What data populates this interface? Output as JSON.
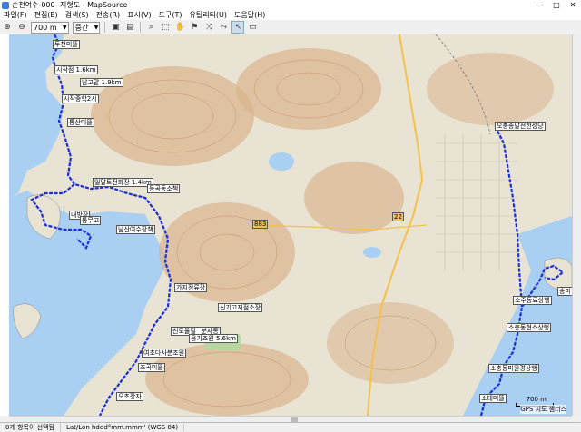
{
  "window": {
    "title": "순천여수-000- 지형도 - MapSource",
    "min": "—",
    "max": "□",
    "close": "✕"
  },
  "menu": [
    "파일(F)",
    "편집(E)",
    "검색(S)",
    "전송(R)",
    "표시(V)",
    "도구(T)",
    "유틸리티(U)",
    "도움말(H)"
  ],
  "toolbar": {
    "zoom_value": "700 m",
    "detail_value": "중간"
  },
  "map": {
    "scale_label": "700 m",
    "watermark": "GPS 지도 샘터스",
    "pois": [
      {
        "text": "두쳔미뜰",
        "name": "poi-1"
      },
      {
        "text": "시작점 1.6km",
        "name": "poi-2"
      },
      {
        "text": "남고말 1.9km",
        "name": "poi-3"
      },
      {
        "text": "시작중학2시",
        "name": "poi-4"
      },
      {
        "text": "통산미뜰",
        "name": "poi-5"
      },
      {
        "text": "일달트전화장 1.4km",
        "name": "poi-6"
      },
      {
        "text": "등곡동소책",
        "name": "poi-7"
      },
      {
        "text": "내방장",
        "name": "poi-8"
      },
      {
        "text": "통무고",
        "name": "poi-9"
      },
      {
        "text": "남산여수장책",
        "name": "poi-10"
      },
      {
        "text": "가지정류장",
        "name": "poi-11"
      },
      {
        "text": "신기고지점소장",
        "name": "poi-12"
      },
      {
        "text": "신도율딜 _분사통",
        "name": "poi-13"
      },
      {
        "text": "웅기조원 5.6km",
        "name": "poi-14"
      },
      {
        "text": "여초다사분조원",
        "name": "poi-15"
      },
      {
        "text": "조곡미뜰",
        "name": "poi-16"
      },
      {
        "text": "오초장자",
        "name": "poi-17"
      },
      {
        "text": "오충종말전한성당",
        "name": "poi-18"
      },
      {
        "text": "송미",
        "name": "poi-19"
      },
      {
        "text": "소주동료상행",
        "name": "poi-20"
      },
      {
        "text": "소충동현소상행",
        "name": "poi-21"
      },
      {
        "text": "소충동미원경상행",
        "name": "poi-22"
      },
      {
        "text": "소대미뜰",
        "name": "poi-23"
      },
      {
        "text": "883",
        "name": "road-883"
      },
      {
        "text": "22",
        "name": "road-22"
      }
    ]
  },
  "status": {
    "selection": "0개 항목이 선택됨",
    "coord": "Lat/Lon hddd°mm.mmm' (WGS 84)"
  },
  "colors": {
    "track": "#1b2fd6",
    "sea": "#a9cff2",
    "land": "#e9e3d3",
    "road": "#f2c14e",
    "contour": "#b98b5d"
  }
}
